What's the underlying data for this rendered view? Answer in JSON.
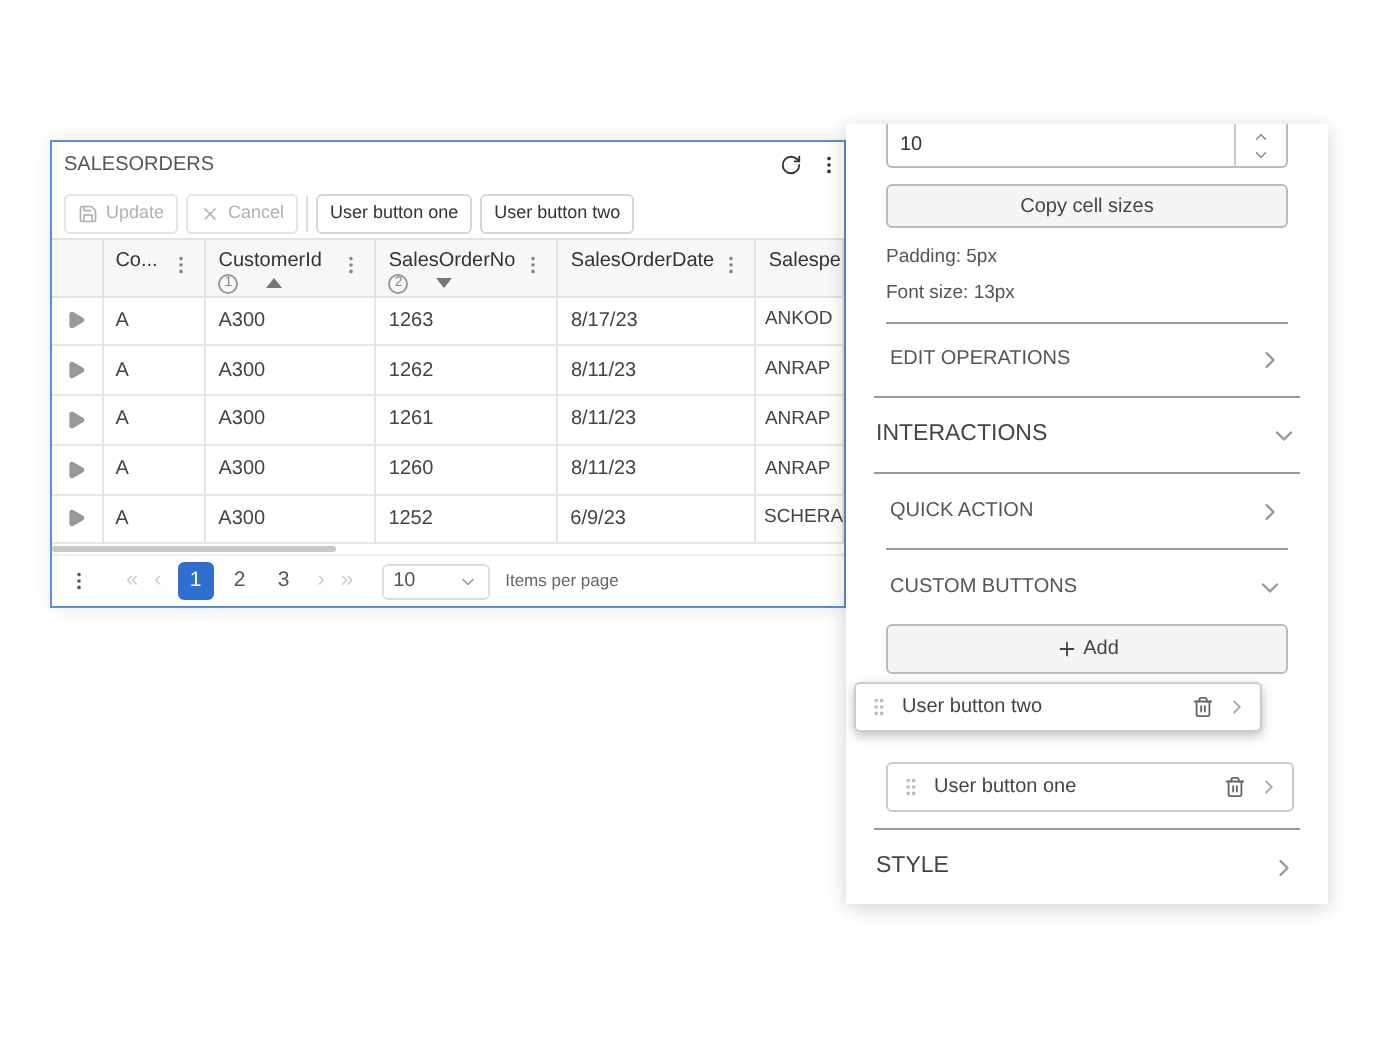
{
  "grid": {
    "title": "SALESORDERS",
    "toolbar": [
      {
        "label": "Update",
        "kind": "update",
        "disabled": true
      },
      {
        "label": "Cancel",
        "kind": "cancel",
        "disabled": true
      },
      {
        "label": "User button one",
        "kind": "custom",
        "disabled": false
      },
      {
        "label": "User button two",
        "kind": "custom",
        "disabled": false
      }
    ],
    "columns": [
      {
        "label": "Co...",
        "sort_ascending": false,
        "sort_descending": false,
        "menu": true
      },
      {
        "label": "CustomerId",
        "sort_ascending": true,
        "sort_descending": false,
        "sort_order": "1",
        "menu": true
      },
      {
        "label": "SalesOrderNo",
        "sort_ascending": false,
        "sort_descending": true,
        "sort_order": "2",
        "menu": true
      },
      {
        "label": "SalesOrderDate",
        "sort_ascending": false,
        "sort_descending": false,
        "menu": true
      },
      {
        "label": "Salespe"
      }
    ],
    "rows": [
      [
        "A",
        "A300",
        "1263",
        "8/17/23",
        "ANKOD"
      ],
      [
        "A",
        "A300",
        "1262",
        "8/11/23",
        "ANRAP"
      ],
      [
        "A",
        "A300",
        "1261",
        "8/11/23",
        "ANRAP"
      ],
      [
        "A",
        "A300",
        "1260",
        "8/11/23",
        "ANRAP"
      ],
      [
        "A",
        "A300",
        "1252",
        "6/9/23",
        "SCHERA"
      ]
    ],
    "pager": {
      "first": "«",
      "prev": "‹",
      "next": "›",
      "last": "»",
      "pages": [
        {
          "label": "1",
          "selected": true
        },
        {
          "label": "2",
          "selected": false
        },
        {
          "label": "3",
          "selected": false
        }
      ],
      "page_size": "10",
      "page_size_label": "Items per page"
    }
  },
  "panel": {
    "number_value": "10",
    "copy_button": "Copy cell sizes",
    "info": [
      "Padding: 5px",
      "Font size: 13px"
    ],
    "sections": [
      {
        "title": "EDIT OPERATIONS",
        "kind": "subsection",
        "expanded": false
      },
      {
        "title": "INTERACTIONS",
        "kind": "section",
        "expanded": true
      },
      {
        "title": "QUICK ACTION",
        "kind": "subsection",
        "expanded": false
      },
      {
        "title": "CUSTOM BUTTONS",
        "kind": "subsection",
        "expanded": true
      },
      {
        "title": "STYLE",
        "kind": "section",
        "expanded": false
      }
    ],
    "add_button": "Add",
    "custom_buttons": [
      {
        "label": "User button two",
        "dragging": true
      },
      {
        "label": "User button one",
        "dragging": false
      }
    ]
  }
}
